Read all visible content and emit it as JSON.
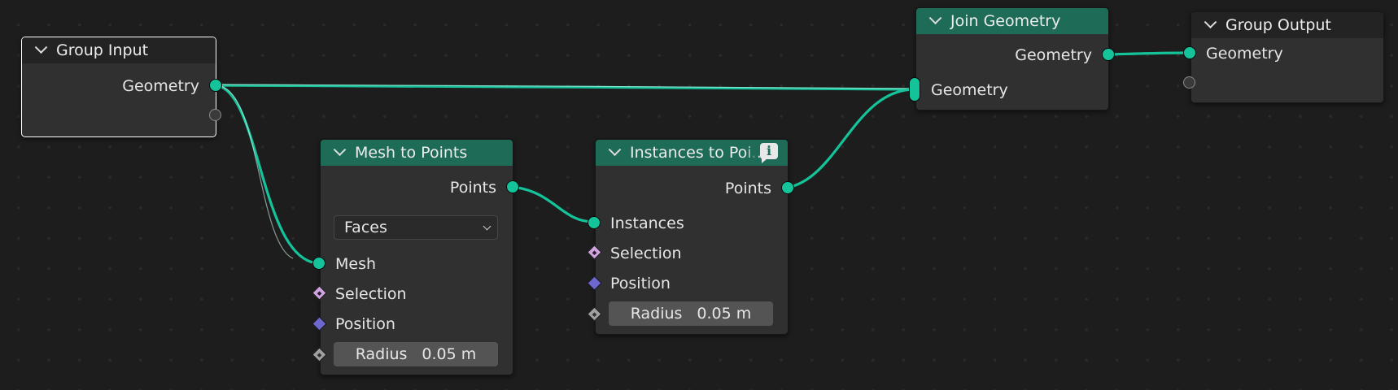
{
  "colors": {
    "geometry_socket": "#14c39a",
    "header_geometry": "#1e6b58",
    "header_group": "#232323",
    "selection_socket": "#cfa3e0",
    "position_socket": "#6c68cf",
    "float_socket": "#a0a0a0"
  },
  "nodes": {
    "group_input": {
      "title": "Group Input",
      "outputs": {
        "geometry": "Geometry"
      }
    },
    "mesh_to_points": {
      "title": "Mesh to Points",
      "outputs": {
        "points": "Points"
      },
      "mode": "Faces",
      "inputs": {
        "mesh": "Mesh",
        "selection": "Selection",
        "position": "Position",
        "radius_label": "Radius",
        "radius_value": "0.05 m"
      }
    },
    "instances_to_points": {
      "title": "Instances to Poi...",
      "info_icon": "info-icon",
      "outputs": {
        "points": "Points"
      },
      "inputs": {
        "instances": "Instances",
        "selection": "Selection",
        "position": "Position",
        "radius_label": "Radius",
        "radius_value": "0.05 m"
      }
    },
    "join_geometry": {
      "title": "Join Geometry",
      "outputs": {
        "geometry": "Geometry"
      },
      "inputs": {
        "geometry": "Geometry"
      }
    },
    "group_output": {
      "title": "Group Output",
      "inputs": {
        "geometry": "Geometry"
      }
    }
  }
}
